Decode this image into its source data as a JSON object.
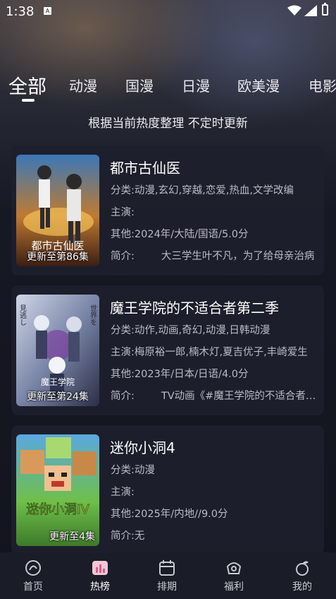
{
  "status_bar": {
    "time": "1:38",
    "notification_glyph": "A"
  },
  "tabs": [
    {
      "label": "全部",
      "active": true
    },
    {
      "label": "动漫"
    },
    {
      "label": "国漫"
    },
    {
      "label": "日漫"
    },
    {
      "label": "欧美漫"
    },
    {
      "label": "电影"
    }
  ],
  "subtitle": "根据当前热度整理 不定时更新",
  "row_labels": {
    "category": "分类:",
    "cast": "主演:",
    "other": "其他:",
    "intro": "简介:"
  },
  "items": [
    {
      "title": "都市古仙医",
      "poster_label": "更新至第86集",
      "poster_art_text": "都市古仙医",
      "category": "动漫,玄幻,穿越,恋爱,热血,文学改编",
      "cast": "",
      "other": "2024年/大陆/国语/5.0分",
      "intro": "大三学生叶不凡，为了给母亲治病"
    },
    {
      "title": "魔王学院的不适合者第二季",
      "poster_label": "更新至第24集",
      "poster_art_text": "魔王学院",
      "category": "动作,动画,奇幻,动漫,日韩动漫",
      "cast": "梅原裕一郎,楠木灯,夏吉优子,丰崎爱生",
      "other": "2023年/日本/日语/4.0分",
      "intro": "TV动画《#魔王学院的不适合者》第二季"
    },
    {
      "title": "迷你小洞4",
      "poster_label": "更新至4集",
      "poster_art_text": "迷你小洞IV",
      "category": "动漫",
      "cast": "",
      "other": "2025年/内地//9.0分",
      "intro": "无"
    }
  ],
  "bottom_nav": [
    {
      "label": "首页",
      "icon": "home-icon"
    },
    {
      "label": "热榜",
      "icon": "hot-chart-icon",
      "active": true
    },
    {
      "label": "排期",
      "icon": "calendar-icon"
    },
    {
      "label": "福利",
      "icon": "gift-icon"
    },
    {
      "label": "我的",
      "icon": "profile-icon"
    }
  ],
  "colors": {
    "background": "#12141e",
    "card": "#1e202c",
    "accent": "#e05a8a"
  }
}
